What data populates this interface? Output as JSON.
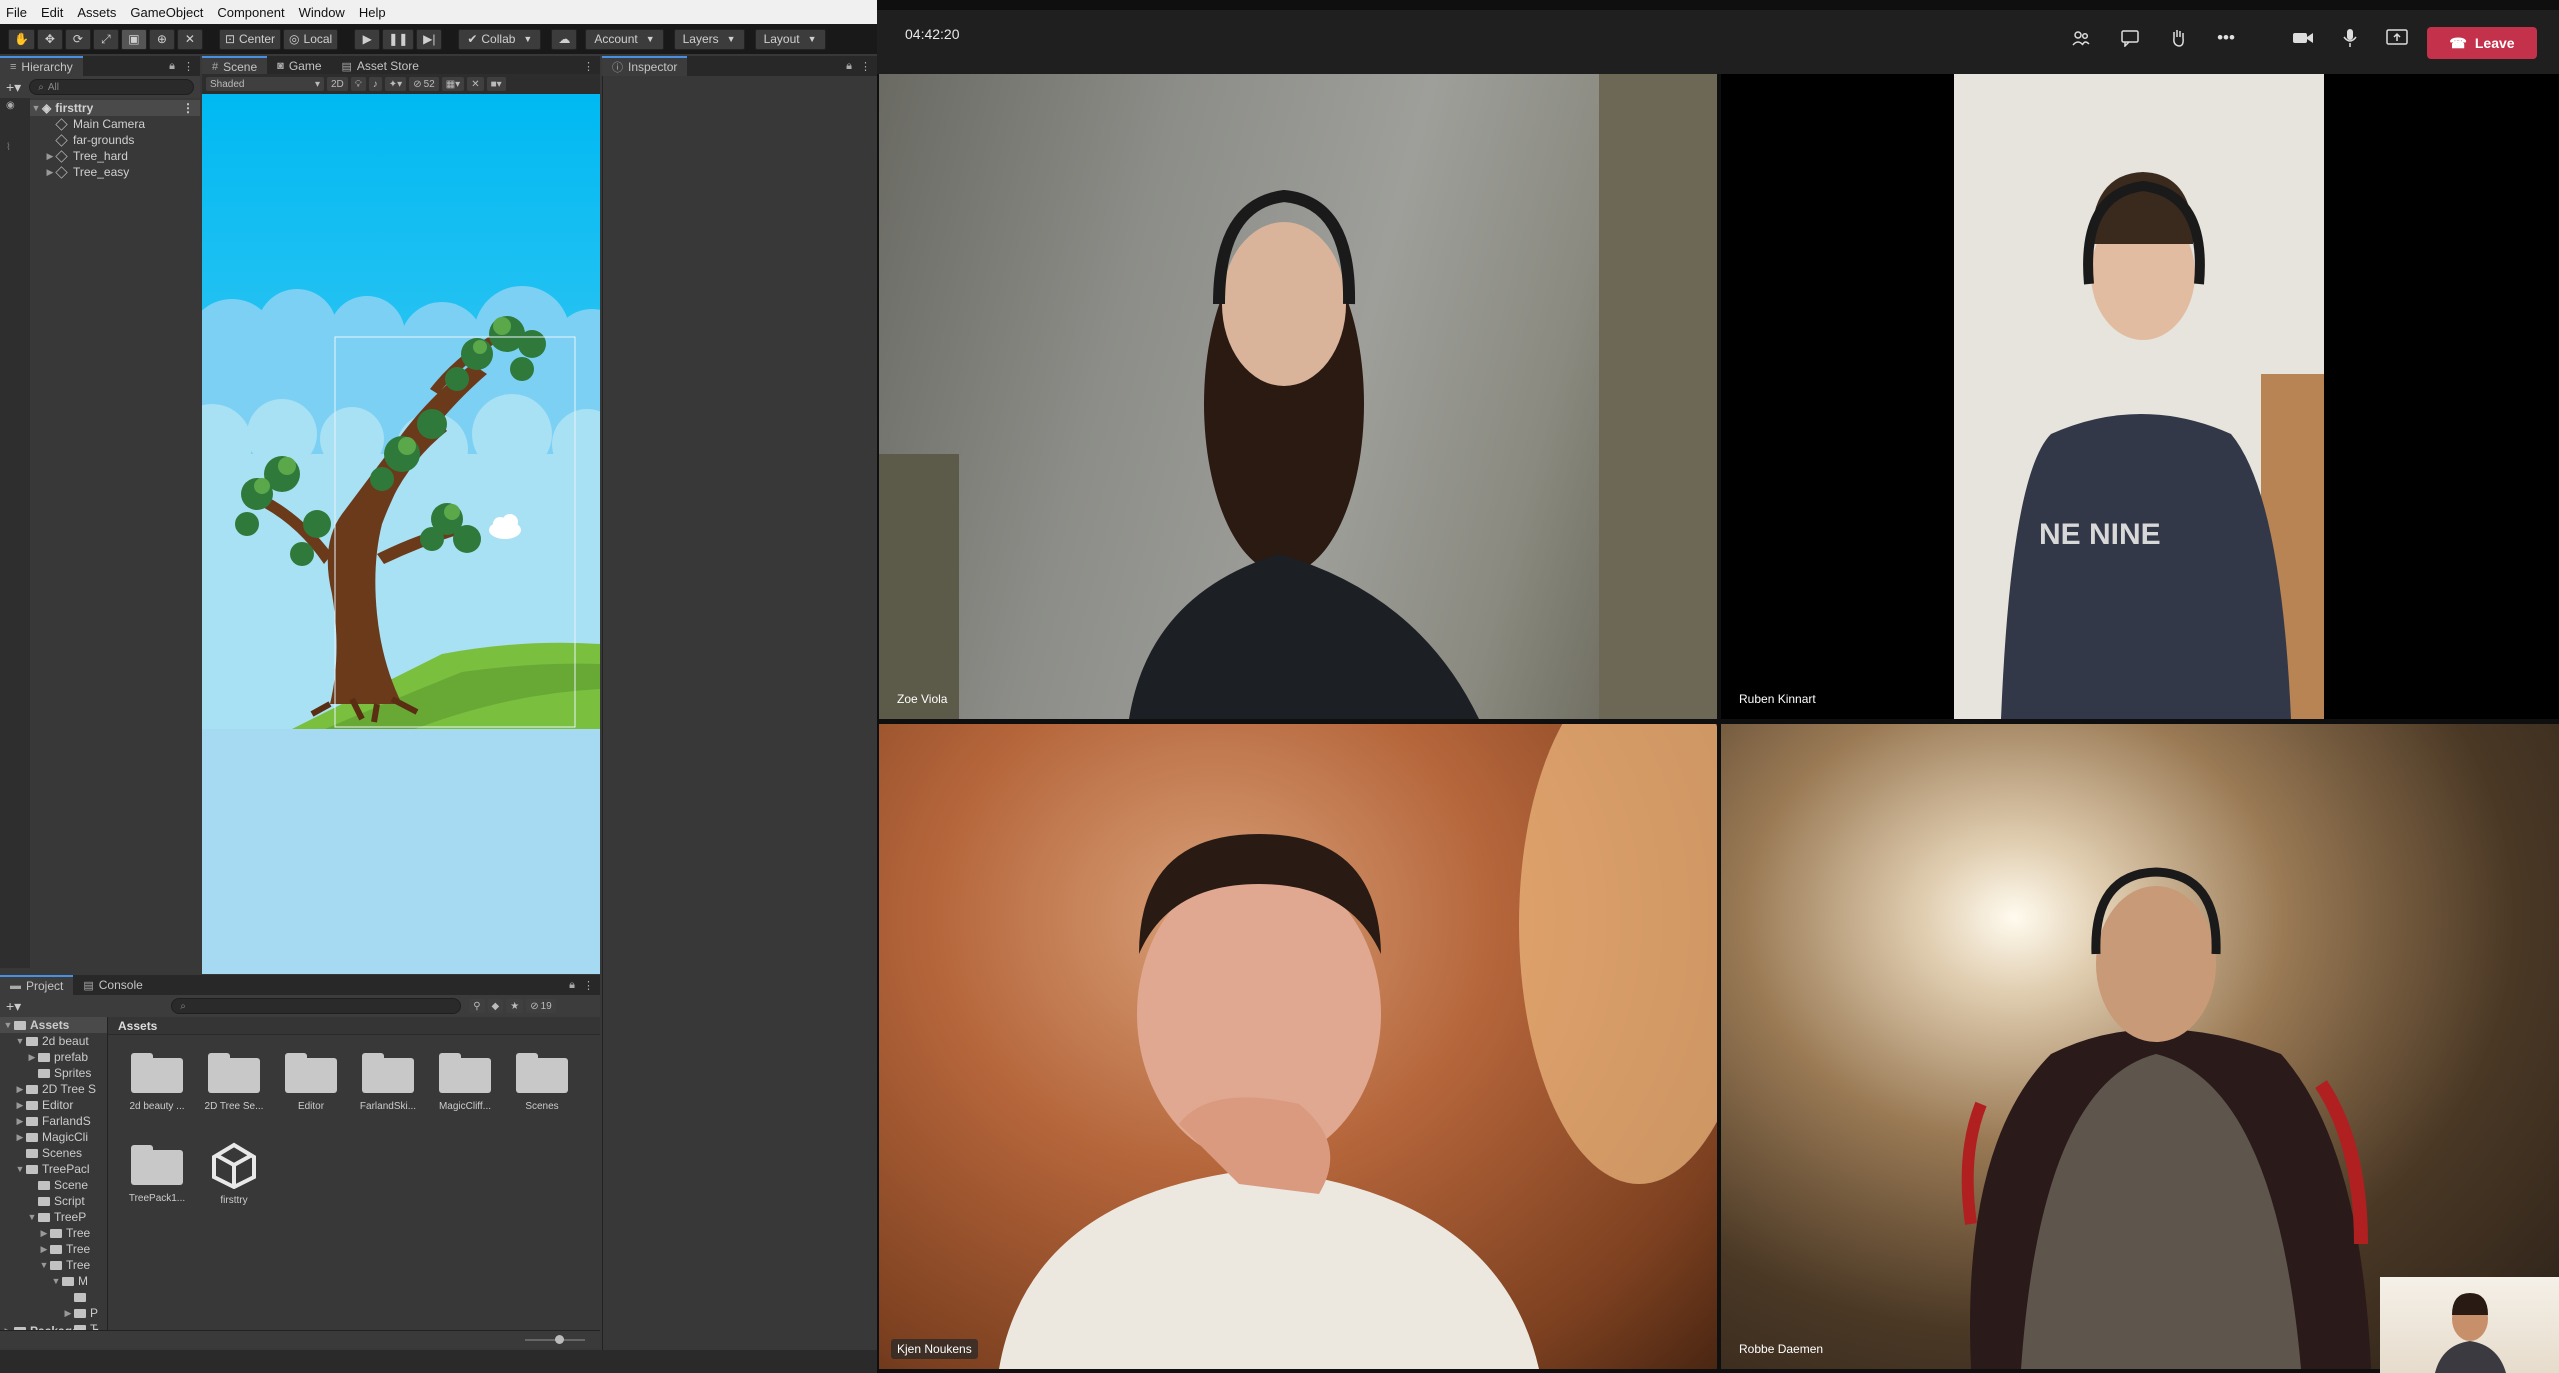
{
  "unity": {
    "menu": [
      "File",
      "Edit",
      "Assets",
      "GameObject",
      "Component",
      "Window",
      "Help"
    ],
    "toolbar": {
      "pivot_label": "Center",
      "space_label": "Local",
      "collab_label": "Collab",
      "account_label": "Account",
      "layers_label": "Layers",
      "layout_label": "Layout"
    },
    "hierarchy": {
      "tab": "Hierarchy",
      "search_placeholder": "All",
      "scene": "firsttry",
      "items": [
        "Main Camera",
        "far-grounds",
        "Tree_hard",
        "Tree_easy"
      ]
    },
    "scene": {
      "tabs": [
        "Scene",
        "Game",
        "Asset Store"
      ],
      "shading_mode": "Shaded",
      "mode_2d": "2D",
      "hidden_count": "52"
    },
    "inspector": {
      "tab": "Inspector"
    },
    "project": {
      "tabs": [
        "Project",
        "Console"
      ],
      "hidden_count": "19",
      "breadcrumb": "Assets",
      "tree": [
        {
          "label": "Assets",
          "indent": 0,
          "expanded": true
        },
        {
          "label": "2d beaut",
          "indent": 1,
          "expanded": true
        },
        {
          "label": "prefab",
          "indent": 2
        },
        {
          "label": "Sprites",
          "indent": 2
        },
        {
          "label": "2D Tree S",
          "indent": 1
        },
        {
          "label": "Editor",
          "indent": 1
        },
        {
          "label": "FarlandS",
          "indent": 1
        },
        {
          "label": "MagicCli",
          "indent": 1
        },
        {
          "label": "Scenes",
          "indent": 1
        },
        {
          "label": "TreePacl",
          "indent": 1,
          "expanded": true
        },
        {
          "label": "Scene",
          "indent": 2
        },
        {
          "label": "Script",
          "indent": 2
        },
        {
          "label": "TreeP",
          "indent": 2,
          "expanded": true
        },
        {
          "label": "Tree",
          "indent": 3
        },
        {
          "label": "Tree",
          "indent": 3
        },
        {
          "label": "Tree",
          "indent": 3,
          "expanded": true
        },
        {
          "label": "M",
          "indent": 4
        },
        {
          "label": "",
          "indent": 4
        },
        {
          "label": "P",
          "indent": 4
        },
        {
          "label": "T",
          "indent": 4
        }
      ],
      "packages_label": "Packages",
      "assets": [
        "2d beauty ...",
        "2D Tree Se...",
        "Editor",
        "FarlandSki...",
        "MagicCliff...",
        "Scenes",
        "TreePack1...",
        "firsttry"
      ]
    }
  },
  "teams": {
    "call_time": "04:42:20",
    "leave_label": "Leave",
    "participants": [
      "Zoe Viola",
      "Ruben Kinnart",
      "Kjen Noukens",
      "Robbe Daemen"
    ],
    "controls": [
      "people-icon",
      "chat-icon",
      "raise-hand-icon",
      "more-icon",
      "camera-icon",
      "mic-icon",
      "share-icon"
    ]
  }
}
